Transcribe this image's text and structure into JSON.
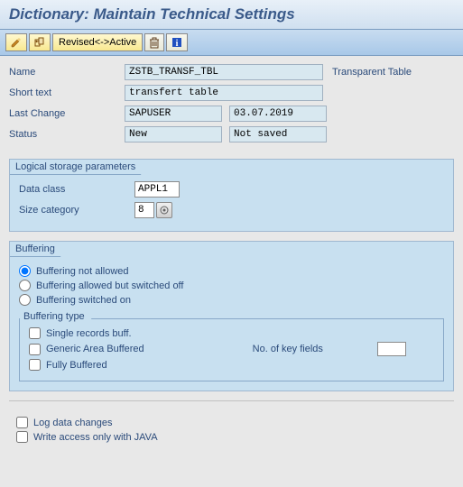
{
  "title": "Dictionary: Maintain Technical Settings",
  "toolbar": {
    "revised": "Revised<->Active"
  },
  "header": {
    "name_lbl": "Name",
    "name_val": "ZSTB_TRANSF_TBL",
    "table_type": "Transparent Table",
    "short_lbl": "Short text",
    "short_val": "transfert table",
    "change_lbl": "Last Change",
    "change_user": "SAPUSER",
    "change_date": "03.07.2019",
    "status_lbl": "Status",
    "status_val": "New",
    "status_saved": "Not saved"
  },
  "lsp": {
    "title": "Logical storage parameters",
    "dataclass_lbl": "Data class",
    "dataclass_val": "APPL1",
    "sizecat_lbl": "Size category",
    "sizecat_val": "8"
  },
  "buffering": {
    "title": "Buffering",
    "opt1": "Buffering not allowed",
    "opt2": "Buffering allowed but switched off",
    "opt3": "Buffering switched on",
    "type_title": "Buffering type",
    "t1": "Single records buff.",
    "t2": "Generic Area Buffered",
    "t3": "Fully Buffered",
    "keyfields_lbl": "No. of key fields"
  },
  "bottom": {
    "log": "Log data changes",
    "java": "Write access only with JAVA"
  }
}
